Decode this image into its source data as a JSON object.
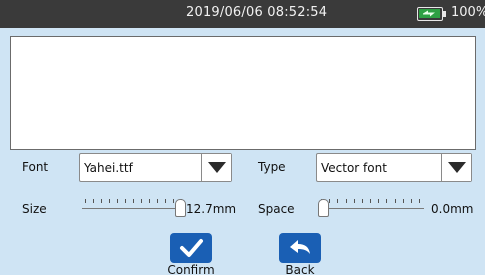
{
  "status_bar": {
    "datetime": "2019/06/06  08:52:54",
    "battery_percent": "100%",
    "battery_level": 1.0
  },
  "form": {
    "font": {
      "label": "Font",
      "value": "Yahei.ttf"
    },
    "type": {
      "label": "Type",
      "value": "Vector font"
    },
    "size": {
      "label": "Size",
      "value": "12.7mm",
      "level": 1.0
    },
    "space": {
      "label": "Space",
      "value": "0.0mm",
      "level": 0.0
    }
  },
  "actions": {
    "confirm_label": "Confirm",
    "back_label": "Back"
  },
  "colors": {
    "background": "#cfe4f4",
    "status_bar": "#3a3a3a",
    "button_blue": "#1a5fb4",
    "battery_charge": "#2ea043"
  }
}
